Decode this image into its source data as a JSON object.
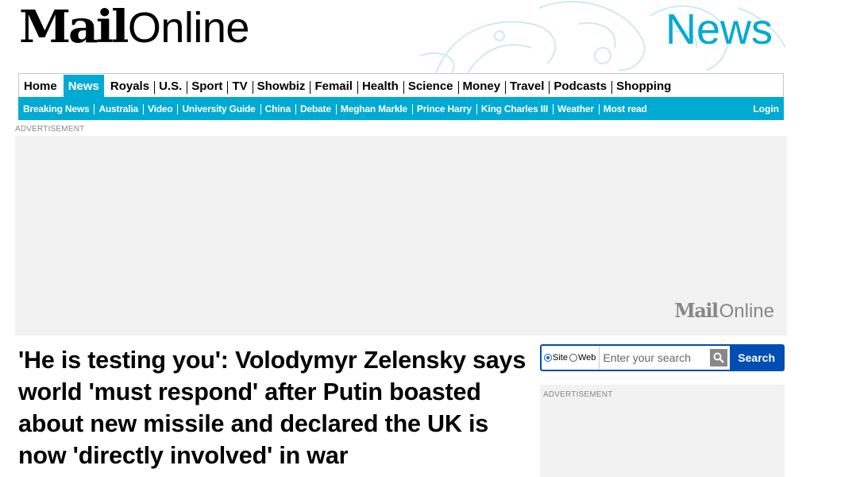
{
  "brand": {
    "logo_mail": "Mail",
    "logo_online": "Online",
    "section": "News"
  },
  "nav": {
    "primary": [
      {
        "label": "Home",
        "active": false
      },
      {
        "label": "News",
        "active": true
      },
      {
        "label": "Royals",
        "active": false
      },
      {
        "label": "U.S.",
        "active": false
      },
      {
        "label": "Sport",
        "active": false
      },
      {
        "label": "TV",
        "active": false
      },
      {
        "label": "Showbiz",
        "active": false
      },
      {
        "label": "Femail",
        "active": false
      },
      {
        "label": "Health",
        "active": false
      },
      {
        "label": "Science",
        "active": false
      },
      {
        "label": "Money",
        "active": false
      },
      {
        "label": "Travel",
        "active": false
      },
      {
        "label": "Podcasts",
        "active": false
      },
      {
        "label": "Shopping",
        "active": false
      }
    ],
    "secondary": [
      "Breaking News",
      "Australia",
      "Video",
      "University Guide",
      "China",
      "Debate",
      "Meghan Markle",
      "Prince Harry",
      "King Charles III",
      "Weather",
      "Most read"
    ],
    "login": "Login"
  },
  "ads": {
    "label": "ADVERTISEMENT",
    "top_logo_mail": "Mail",
    "top_logo_online": "Online"
  },
  "article": {
    "headline": "'He is testing you': Volodymyr Zelensky says world 'must respond' after Putin boasted about new missile and declared the UK is now 'directly involved' in war"
  },
  "search": {
    "option_site": "Site",
    "option_web": "Web",
    "selected": "Site",
    "placeholder": "Enter your search",
    "button": "Search"
  },
  "colors": {
    "accent": "#00aad2",
    "search_blue": "#004db3",
    "ad_bg": "#f2f2f2"
  },
  "icons": {
    "search": "search-icon"
  }
}
